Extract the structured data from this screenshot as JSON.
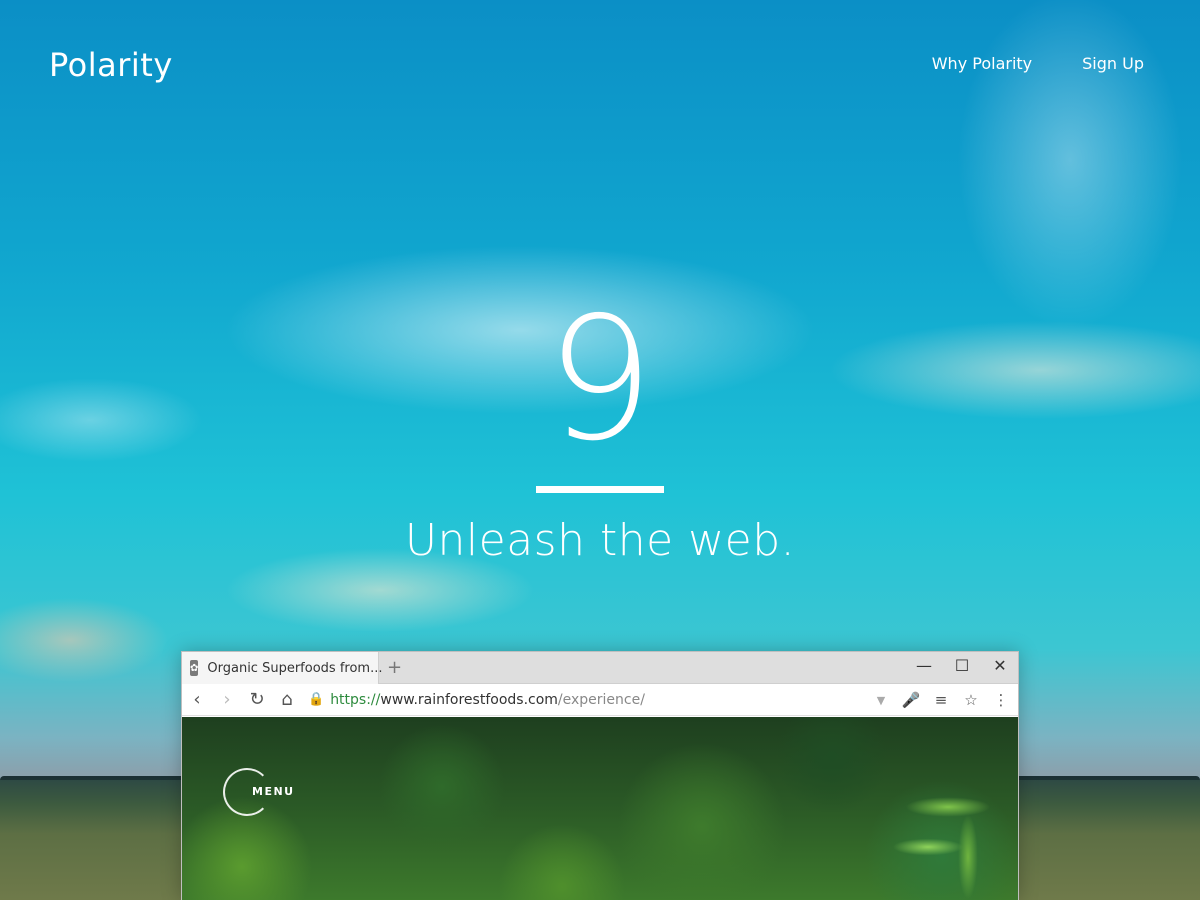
{
  "header": {
    "logo": "Polarity",
    "nav": [
      {
        "label": "Why Polarity"
      },
      {
        "label": "Sign Up"
      }
    ]
  },
  "hero": {
    "number": "9",
    "tagline": "Unleash the web."
  },
  "browser": {
    "tab": {
      "title": "Organic  Superfoods  from...",
      "favicon": "leaf-icon"
    },
    "new_tab_label": "+",
    "window_controls": {
      "minimize": "—",
      "maximize": "☐",
      "close": "✕"
    },
    "toolbar": {
      "back": "‹",
      "forward": "›",
      "reload": "↻",
      "home": "⌂"
    },
    "address": {
      "scheme": "https://",
      "host": "www.rainforestfoods.com",
      "path": "/experience/"
    },
    "toolbar_right": {
      "dropdown": "▼",
      "mic": "🎤",
      "reader": "≡",
      "bookmark": "☆",
      "more": "⋮"
    },
    "page": {
      "menu_label": "MENU"
    }
  },
  "colors": {
    "sky_top": "#0b8fc6",
    "sky_mid": "#1fc2d6",
    "url_green": "#2e8b3e"
  }
}
